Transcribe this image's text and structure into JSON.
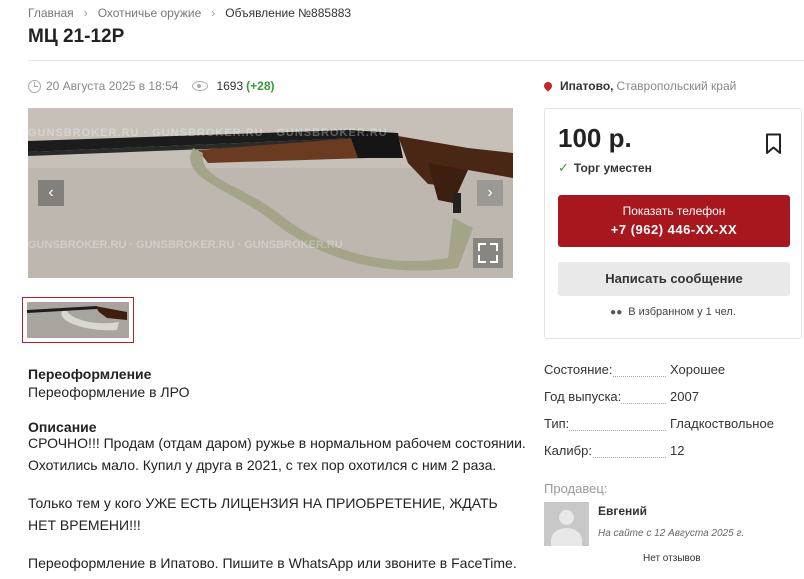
{
  "breadcrumb": {
    "home": "Главная",
    "category": "Охотничье оружие",
    "current": "Объявление №885883"
  },
  "title": "МЦ 21-12Р",
  "meta": {
    "date": "20 Августа 2025 в 18:54",
    "views": "1693",
    "views_delta": "(+28)"
  },
  "gallery": {
    "watermark": "GUNSBROKER.RU · GUNSBROKER.RU · GUNSBROKER.RU"
  },
  "sections": {
    "reg_title": "Переоформление",
    "reg_text": "Переоформление в ЛРО",
    "desc_title": "Описание",
    "desc_p1": "СРОЧНО!!! Продам (отдам даром) ружье в нормальном рабочем состоянии. Охотились мало. Купил у друга в 2021, с тех пор охотился с ним 2 раза.",
    "desc_p2": "Только тем у кого УЖЕ ЕСТЬ ЛИЦЕНЗИЯ НА ПРИОБРЕТЕНИЕ, ЖДАТЬ НЕТ ВРЕМЕНИ!!!",
    "desc_p3": "Переоформление в Ипатово. Пишите в WhatsApp или звоните в FaceTime."
  },
  "location": {
    "city": "Ипатово,",
    "region": "Ставропольский край"
  },
  "offer": {
    "price": "100 р.",
    "bargain": "Торг уместен",
    "phone_label": "Показать телефон",
    "phone_number": "+7 (962) 446-XX-XX",
    "message_label": "Написать сообщение",
    "favorites": "В избранном у 1 чел."
  },
  "specs": [
    {
      "key": "Состояние:",
      "value": "Хорошее"
    },
    {
      "key": "Год выпуска:",
      "value": "2007"
    },
    {
      "key": "Тип:",
      "value": "Гладкоствольное"
    },
    {
      "key": "Калибр:",
      "value": "12"
    }
  ],
  "seller": {
    "label": "Продавец:",
    "name": "Евгений",
    "since": "На сайте с 12 Августа 2025 г.",
    "reviews": "Нет отзывов"
  },
  "colors": {
    "accent": "#a8171e",
    "green": "#3a9a3a"
  }
}
